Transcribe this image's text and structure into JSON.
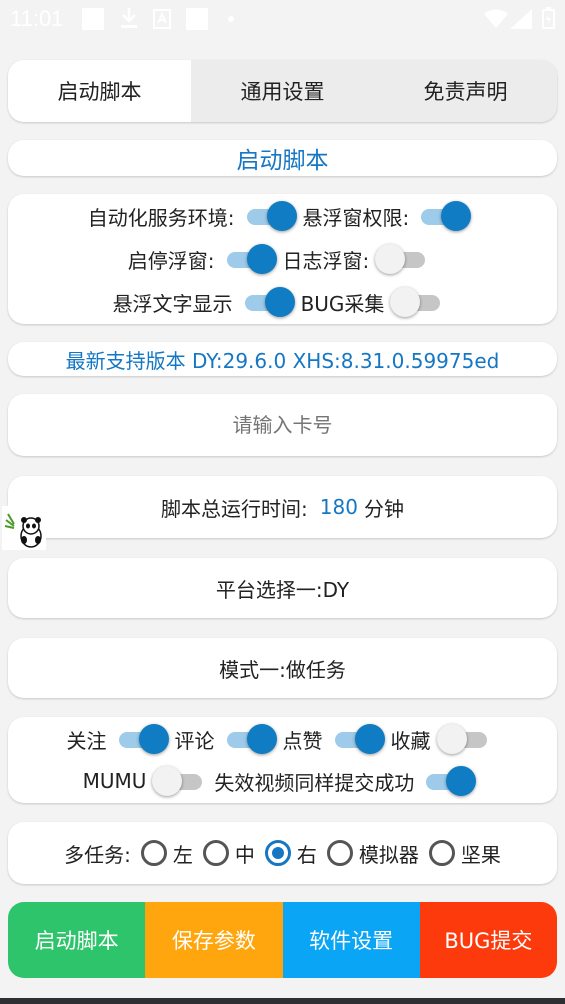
{
  "status_bar": {
    "time": "11:01"
  },
  "tabs": [
    {
      "label": "启动脚本",
      "active": true
    },
    {
      "label": "通用设置",
      "active": false
    },
    {
      "label": "免责声明",
      "active": false
    }
  ],
  "section_title": "启动脚本",
  "permissions": {
    "automation_service_label": "自动化服务环境:",
    "automation_service_on": true,
    "float_permission_label": "悬浮窗权限:",
    "float_permission_on": true,
    "startstop_float_label": "启停浮窗:",
    "startstop_float_on": true,
    "log_float_label": "日志浮窗:",
    "log_float_on": false,
    "float_text_label": "悬浮文字显示",
    "float_text_on": true,
    "bug_collect_label": "BUG采集",
    "bug_collect_on": false
  },
  "version_text": "最新支持版本 DY:29.6.0 XHS:8.31.0.59975ed",
  "card_input": {
    "placeholder": "请输入卡号",
    "value": ""
  },
  "runtime": {
    "label": "脚本总运行时间:",
    "value": "180",
    "unit": "分钟"
  },
  "platform_select": "平台选择一:DY",
  "mode_select": "模式一:做任务",
  "actions": {
    "follow_label": "关注",
    "follow_on": true,
    "comment_label": "评论",
    "comment_on": true,
    "like_label": "点赞",
    "like_on": true,
    "collect_label": "收藏",
    "collect_on": false,
    "mumu_label": "MUMU",
    "mumu_on": false,
    "invalid_video_label": "失效视频同样提交成功",
    "invalid_video_on": true
  },
  "multitask": {
    "label": "多任务:",
    "options": [
      "左",
      "中",
      "右",
      "模拟器",
      "坚果"
    ],
    "selected": "右"
  },
  "buttons": [
    {
      "label": "启动脚本",
      "color": "#2dc46b"
    },
    {
      "label": "保存参数",
      "color": "#ffa60f"
    },
    {
      "label": "软件设置",
      "color": "#0aa5f5"
    },
    {
      "label": "BUG提交",
      "color": "#fc3a0c"
    }
  ],
  "colors": {
    "accent_blue": "#1577c4",
    "toggle_thumb_on": "#0f7cc3",
    "toggle_track_on": "#9ecbea"
  }
}
